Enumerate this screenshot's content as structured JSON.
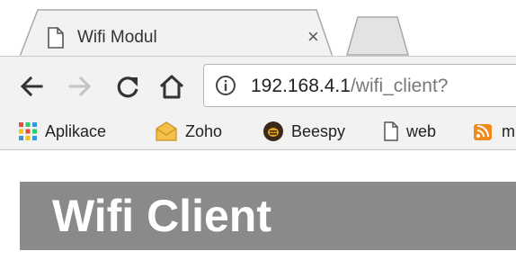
{
  "tab": {
    "title": "Wifi Modul",
    "favicon": "page-icon",
    "close_glyph": "×"
  },
  "toolbar": {
    "back": "back-arrow-icon",
    "forward": "forward-arrow-icon",
    "reload": "reload-icon",
    "home": "home-icon",
    "url_host": "192.168.4.1",
    "url_path": "/wifi_client?",
    "info": "info-icon"
  },
  "bookmarks": [
    {
      "label": "Aplikace",
      "icon": "apps-grid-icon"
    },
    {
      "label": "Zoho",
      "icon": "mail-envelope-icon"
    },
    {
      "label": "Beespy",
      "icon": "bee-icon"
    },
    {
      "label": "web",
      "icon": "page-icon"
    },
    {
      "label": "m",
      "icon": "rss-icon"
    }
  ],
  "page": {
    "title": "Wifi Client"
  },
  "colors": {
    "banner": "#8a8a8a",
    "toolbar": "#f2f2f2",
    "apps_red": "#e74c3c",
    "apps_green": "#2ecc71",
    "apps_blue": "#3498db",
    "apps_yellow": "#f1c40f"
  }
}
